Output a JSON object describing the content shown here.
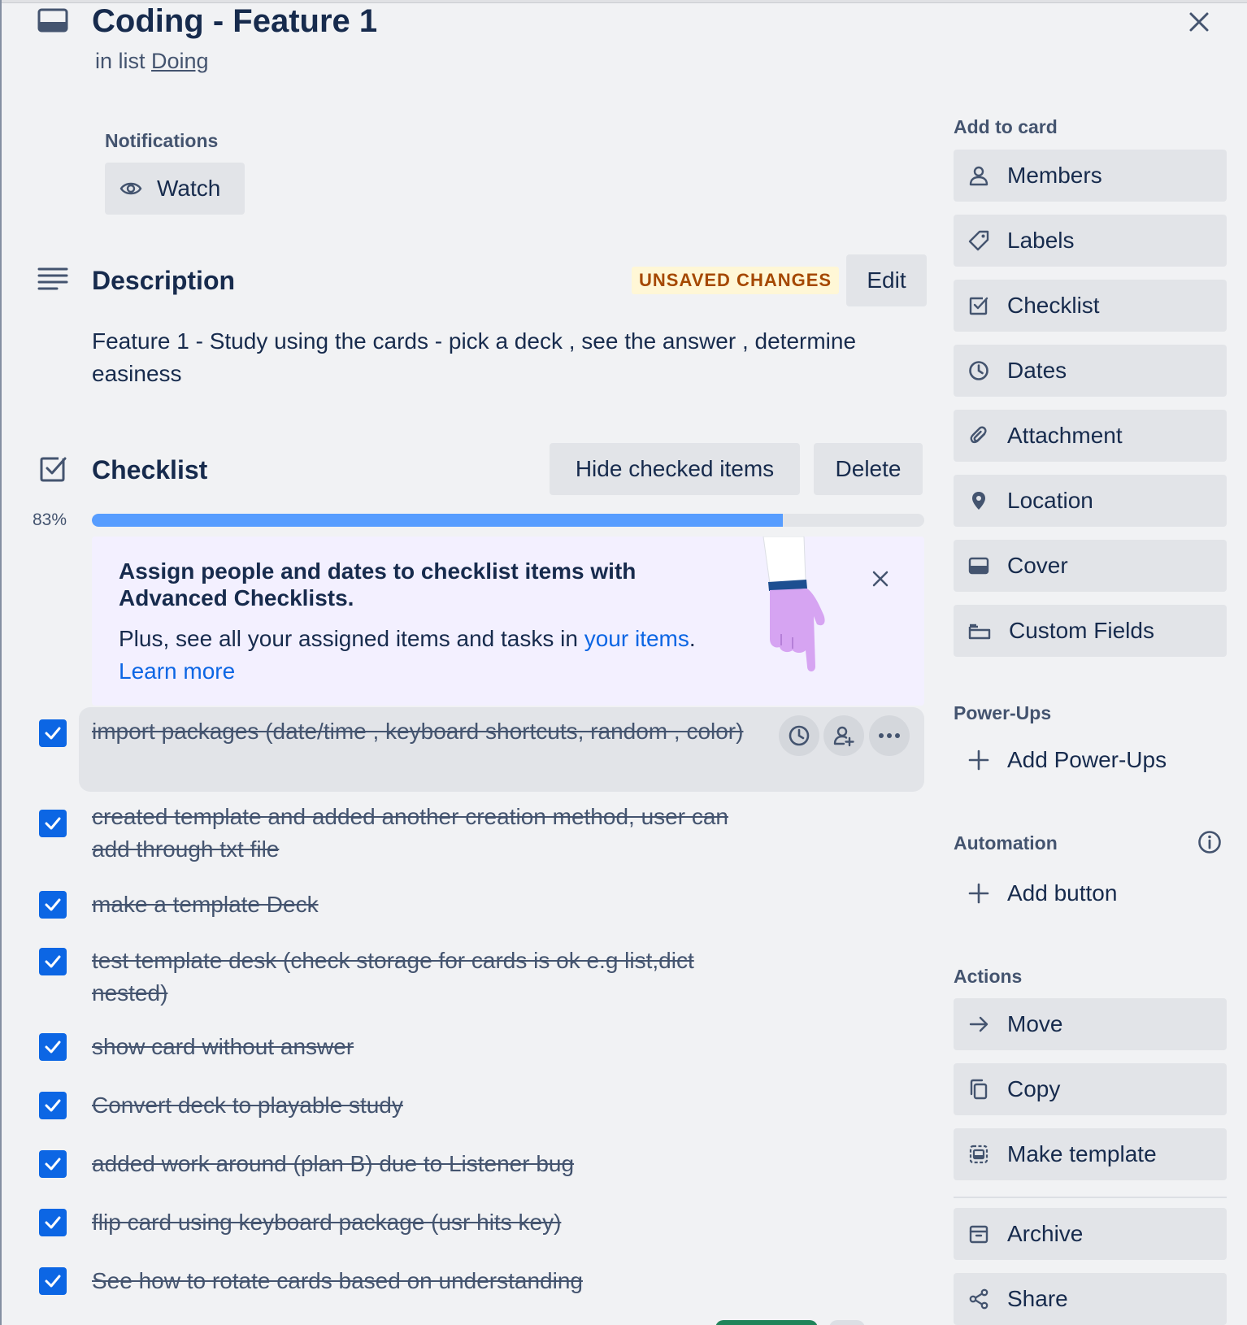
{
  "card": {
    "title": "Coding - Feature 1",
    "in_list_prefix": "in list",
    "list_name": "Doing"
  },
  "notifications": {
    "label": "Notifications",
    "watch_label": "Watch"
  },
  "description": {
    "heading": "Description",
    "unsaved_badge": "UNSAVED CHANGES",
    "edit_label": "Edit",
    "text": "Feature 1 - Study using the cards - pick a deck , see the answer , determine easiness"
  },
  "checklist": {
    "heading": "Checklist",
    "hide_checked_label": "Hide checked items",
    "delete_label": "Delete",
    "percent_text": "83%",
    "progress": 0.83,
    "promo": {
      "title": "Assign people and dates to checklist items with Advanced Checklists.",
      "body_prefix": "Plus, see all your assigned items and tasks in ",
      "your_items_link": "your items",
      "body_suffix": ".",
      "learn_more": "Learn more"
    },
    "items": [
      {
        "text": "import packages (date/time , keyboard shortcuts, random , color)",
        "checked": true
      },
      {
        "text": "created template and added another creation method, user can add through txt file",
        "checked": true
      },
      {
        "text": "make a template Deck",
        "checked": true
      },
      {
        "text": "test template desk (check storage for cards is ok e.g list,dict nested)",
        "checked": true
      },
      {
        "text": "show card without answer",
        "checked": true
      },
      {
        "text": "Convert deck to playable study",
        "checked": true
      },
      {
        "text": "added work around (plan B) due to Listener bug",
        "checked": true
      },
      {
        "text": "flip card using keyboard package (usr hits key)",
        "checked": true
      },
      {
        "text": "See how to rotate cards based on understanding",
        "checked": true
      }
    ]
  },
  "sidebar": {
    "add_to_card_label": "Add to card",
    "add_to_card": [
      {
        "label": "Members",
        "icon": "member-icon"
      },
      {
        "label": "Labels",
        "icon": "label-icon"
      },
      {
        "label": "Checklist",
        "icon": "checklist-icon"
      },
      {
        "label": "Dates",
        "icon": "clock-icon"
      },
      {
        "label": "Attachment",
        "icon": "paperclip-icon"
      },
      {
        "label": "Location",
        "icon": "location-pin-icon"
      },
      {
        "label": "Cover",
        "icon": "cover-icon"
      },
      {
        "label": "Custom Fields",
        "icon": "custom-fields-icon"
      }
    ],
    "powerups_label": "Power-Ups",
    "add_powerups": "Add Power-Ups",
    "automation_label": "Automation",
    "add_button": "Add button",
    "actions_label": "Actions",
    "actions": [
      {
        "label": "Move",
        "icon": "arrow-right-icon"
      },
      {
        "label": "Copy",
        "icon": "copy-icon"
      },
      {
        "label": "Make template",
        "icon": "template-icon"
      }
    ],
    "archive": "Archive",
    "share": "Share"
  },
  "colors": {
    "accent": "#0c66e4",
    "progress": "#579dff",
    "unsaved_bg": "#fff7d6",
    "unsaved_text": "#a54800",
    "promo_bg": "#f3f0ff"
  }
}
